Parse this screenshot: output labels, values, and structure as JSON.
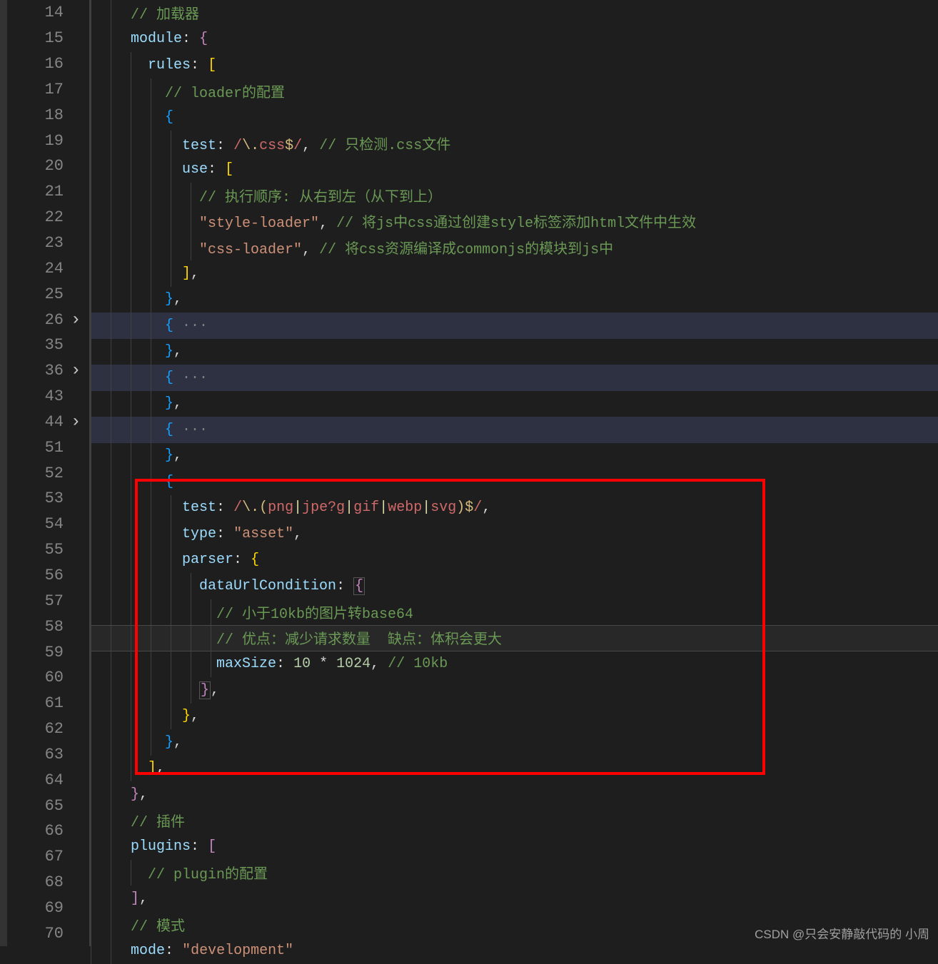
{
  "lines": [
    {
      "num": "14",
      "fold": false,
      "bg": "",
      "indent": 1,
      "tokens": [
        [
          "    ",
          "tk-default"
        ],
        [
          "// 加载器",
          "tk-comment"
        ]
      ]
    },
    {
      "num": "15",
      "fold": false,
      "bg": "",
      "indent": 1,
      "tokens": [
        [
          "    ",
          "tk-default"
        ],
        [
          "module",
          "tk-property"
        ],
        [
          ":",
          "tk-default"
        ],
        [
          " ",
          "tk-default"
        ],
        [
          "{",
          "tk-brace-purple"
        ]
      ]
    },
    {
      "num": "16",
      "fold": false,
      "bg": "",
      "indent": 2,
      "tokens": [
        [
          "      ",
          "tk-default"
        ],
        [
          "rules",
          "tk-property"
        ],
        [
          ":",
          "tk-default"
        ],
        [
          " ",
          "tk-default"
        ],
        [
          "[",
          "tk-bracket-yellow"
        ]
      ]
    },
    {
      "num": "17",
      "fold": false,
      "bg": "",
      "indent": 3,
      "tokens": [
        [
          "        ",
          "tk-default"
        ],
        [
          "// loader的配置",
          "tk-comment"
        ]
      ]
    },
    {
      "num": "18",
      "fold": false,
      "bg": "",
      "indent": 3,
      "tokens": [
        [
          "        ",
          "tk-default"
        ],
        [
          "{",
          "tk-brace-blue"
        ]
      ]
    },
    {
      "num": "19",
      "fold": false,
      "bg": "",
      "indent": 4,
      "tokens": [
        [
          "          ",
          "tk-default"
        ],
        [
          "test",
          "tk-property"
        ],
        [
          ":",
          "tk-default"
        ],
        [
          " ",
          "tk-default"
        ],
        [
          "/",
          "tk-regex"
        ],
        [
          "\\.",
          "tk-regex-esc"
        ],
        [
          "css",
          "tk-regex"
        ],
        [
          "$",
          "tk-regex-esc"
        ],
        [
          "/",
          "tk-regex"
        ],
        [
          ",",
          "tk-default"
        ],
        [
          " ",
          "tk-default"
        ],
        [
          "// 只检测.css文件",
          "tk-comment"
        ]
      ]
    },
    {
      "num": "20",
      "fold": false,
      "bg": "",
      "indent": 4,
      "tokens": [
        [
          "          ",
          "tk-default"
        ],
        [
          "use",
          "tk-property"
        ],
        [
          ":",
          "tk-default"
        ],
        [
          " ",
          "tk-default"
        ],
        [
          "[",
          "tk-brace-yellow"
        ]
      ]
    },
    {
      "num": "21",
      "fold": false,
      "bg": "",
      "indent": 5,
      "tokens": [
        [
          "            ",
          "tk-default"
        ],
        [
          "// 执行顺序: 从右到左（从下到上）",
          "tk-comment"
        ]
      ]
    },
    {
      "num": "22",
      "fold": false,
      "bg": "",
      "indent": 5,
      "tokens": [
        [
          "            ",
          "tk-default"
        ],
        [
          "\"style-loader\"",
          "tk-string"
        ],
        [
          ",",
          "tk-default"
        ],
        [
          " ",
          "tk-default"
        ],
        [
          "// 将js中css通过创建style标签添加html文件中生效",
          "tk-comment"
        ]
      ]
    },
    {
      "num": "23",
      "fold": false,
      "bg": "",
      "indent": 5,
      "tokens": [
        [
          "            ",
          "tk-default"
        ],
        [
          "\"css-loader\"",
          "tk-string"
        ],
        [
          ",",
          "tk-default"
        ],
        [
          " ",
          "tk-default"
        ],
        [
          "// 将css资源编译成commonjs的模块到js中",
          "tk-comment"
        ]
      ]
    },
    {
      "num": "24",
      "fold": false,
      "bg": "",
      "indent": 4,
      "tokens": [
        [
          "          ",
          "tk-default"
        ],
        [
          "]",
          "tk-brace-yellow"
        ],
        [
          ",",
          "tk-default"
        ]
      ]
    },
    {
      "num": "25",
      "fold": false,
      "bg": "",
      "indent": 3,
      "tokens": [
        [
          "        ",
          "tk-default"
        ],
        [
          "}",
          "tk-brace-blue"
        ],
        [
          ",",
          "tk-default"
        ]
      ]
    },
    {
      "num": "26",
      "fold": true,
      "bg": "h",
      "indent": 3,
      "tokens": [
        [
          "        ",
          "tk-default"
        ],
        [
          "{",
          "tk-brace-blue"
        ],
        [
          " ···",
          "tk-fold"
        ]
      ]
    },
    {
      "num": "35",
      "fold": false,
      "bg": "",
      "indent": 3,
      "tokens": [
        [
          "        ",
          "tk-default"
        ],
        [
          "}",
          "tk-brace-blue"
        ],
        [
          ",",
          "tk-default"
        ]
      ]
    },
    {
      "num": "36",
      "fold": true,
      "bg": "h",
      "indent": 3,
      "tokens": [
        [
          "        ",
          "tk-default"
        ],
        [
          "{",
          "tk-brace-blue"
        ],
        [
          " ···",
          "tk-fold"
        ]
      ]
    },
    {
      "num": "43",
      "fold": false,
      "bg": "",
      "indent": 3,
      "tokens": [
        [
          "        ",
          "tk-default"
        ],
        [
          "}",
          "tk-brace-blue"
        ],
        [
          ",",
          "tk-default"
        ]
      ]
    },
    {
      "num": "44",
      "fold": true,
      "bg": "h",
      "indent": 3,
      "tokens": [
        [
          "        ",
          "tk-default"
        ],
        [
          "{",
          "tk-brace-blue"
        ],
        [
          " ···",
          "tk-fold"
        ]
      ]
    },
    {
      "num": "51",
      "fold": false,
      "bg": "",
      "indent": 3,
      "tokens": [
        [
          "        ",
          "tk-default"
        ],
        [
          "}",
          "tk-brace-blue"
        ],
        [
          ",",
          "tk-default"
        ]
      ]
    },
    {
      "num": "52",
      "fold": false,
      "bg": "",
      "indent": 3,
      "tokens": [
        [
          "        ",
          "tk-default"
        ],
        [
          "{",
          "tk-brace-blue"
        ]
      ]
    },
    {
      "num": "53",
      "fold": false,
      "bg": "",
      "indent": 4,
      "tokens": [
        [
          "          ",
          "tk-default"
        ],
        [
          "test",
          "tk-property"
        ],
        [
          ":",
          "tk-default"
        ],
        [
          " ",
          "tk-default"
        ],
        [
          "/",
          "tk-regex"
        ],
        [
          "\\.",
          "tk-regex-esc"
        ],
        [
          "(",
          "tk-regex-esc"
        ],
        [
          "png",
          "tk-regex"
        ],
        [
          "|",
          "tk-regex-pipe"
        ],
        [
          "jpe?g",
          "tk-regex"
        ],
        [
          "|",
          "tk-regex-pipe"
        ],
        [
          "gif",
          "tk-regex"
        ],
        [
          "|",
          "tk-regex-pipe"
        ],
        [
          "webp",
          "tk-regex"
        ],
        [
          "|",
          "tk-regex-pipe"
        ],
        [
          "svg",
          "tk-regex"
        ],
        [
          ")",
          "tk-regex-esc"
        ],
        [
          "$",
          "tk-regex-esc"
        ],
        [
          "/",
          "tk-regex"
        ],
        [
          ",",
          "tk-default"
        ]
      ]
    },
    {
      "num": "54",
      "fold": false,
      "bg": "",
      "indent": 4,
      "tokens": [
        [
          "          ",
          "tk-default"
        ],
        [
          "type",
          "tk-property"
        ],
        [
          ":",
          "tk-default"
        ],
        [
          " ",
          "tk-default"
        ],
        [
          "\"asset\"",
          "tk-string"
        ],
        [
          ",",
          "tk-default"
        ]
      ]
    },
    {
      "num": "55",
      "fold": false,
      "bg": "",
      "indent": 4,
      "tokens": [
        [
          "          ",
          "tk-default"
        ],
        [
          "parser",
          "tk-property"
        ],
        [
          ":",
          "tk-default"
        ],
        [
          " ",
          "tk-default"
        ],
        [
          "{",
          "tk-brace-yellow"
        ]
      ]
    },
    {
      "num": "56",
      "fold": false,
      "bg": "",
      "indent": 5,
      "tokens": [
        [
          "            ",
          "tk-default"
        ],
        [
          "dataUrlCondition",
          "tk-property"
        ],
        [
          ":",
          "tk-default"
        ],
        [
          " ",
          "tk-default"
        ],
        [
          "{",
          "tk-brace-purple highlight-bracket"
        ]
      ]
    },
    {
      "num": "57",
      "fold": false,
      "bg": "",
      "indent": 6,
      "tokens": [
        [
          "              ",
          "tk-default"
        ],
        [
          "// 小于10kb的图片转base64",
          "tk-comment"
        ]
      ]
    },
    {
      "num": "58",
      "fold": false,
      "bg": "c",
      "indent": 6,
      "tokens": [
        [
          "              ",
          "tk-default"
        ],
        [
          "// 优点：减少请求数量  缺点：体积会更大",
          "tk-comment"
        ]
      ]
    },
    {
      "num": "59",
      "fold": false,
      "bg": "",
      "indent": 6,
      "tokens": [
        [
          "              ",
          "tk-default"
        ],
        [
          "maxSize",
          "tk-property"
        ],
        [
          ":",
          "tk-default"
        ],
        [
          " ",
          "tk-default"
        ],
        [
          "10",
          "tk-number"
        ],
        [
          " ",
          "tk-default"
        ],
        [
          "*",
          "tk-default"
        ],
        [
          " ",
          "tk-default"
        ],
        [
          "1024",
          "tk-number"
        ],
        [
          ",",
          "tk-default"
        ],
        [
          " ",
          "tk-default"
        ],
        [
          "// 10kb",
          "tk-comment"
        ]
      ]
    },
    {
      "num": "60",
      "fold": false,
      "bg": "",
      "indent": 5,
      "tokens": [
        [
          "            ",
          "tk-default"
        ],
        [
          "}",
          "tk-brace-purple highlight-bracket"
        ],
        [
          ",",
          "tk-default"
        ]
      ]
    },
    {
      "num": "61",
      "fold": false,
      "bg": "",
      "indent": 4,
      "tokens": [
        [
          "          ",
          "tk-default"
        ],
        [
          "}",
          "tk-brace-yellow"
        ],
        [
          ",",
          "tk-default"
        ]
      ]
    },
    {
      "num": "62",
      "fold": false,
      "bg": "",
      "indent": 3,
      "tokens": [
        [
          "        ",
          "tk-default"
        ],
        [
          "}",
          "tk-brace-blue"
        ],
        [
          ",",
          "tk-default"
        ]
      ]
    },
    {
      "num": "63",
      "fold": false,
      "bg": "",
      "indent": 2,
      "tokens": [
        [
          "      ",
          "tk-default"
        ],
        [
          "]",
          "tk-bracket-yellow"
        ],
        [
          ",",
          "tk-default"
        ]
      ]
    },
    {
      "num": "64",
      "fold": false,
      "bg": "",
      "indent": 1,
      "tokens": [
        [
          "    ",
          "tk-default"
        ],
        [
          "}",
          "tk-brace-purple"
        ],
        [
          ",",
          "tk-default"
        ]
      ]
    },
    {
      "num": "65",
      "fold": false,
      "bg": "",
      "indent": 1,
      "tokens": [
        [
          "    ",
          "tk-default"
        ],
        [
          "// 插件",
          "tk-comment"
        ]
      ]
    },
    {
      "num": "66",
      "fold": false,
      "bg": "",
      "indent": 1,
      "tokens": [
        [
          "    ",
          "tk-default"
        ],
        [
          "plugins",
          "tk-property"
        ],
        [
          ":",
          "tk-default"
        ],
        [
          " ",
          "tk-default"
        ],
        [
          "[",
          "tk-brace-purple"
        ]
      ]
    },
    {
      "num": "67",
      "fold": false,
      "bg": "",
      "indent": 2,
      "tokens": [
        [
          "      ",
          "tk-default"
        ],
        [
          "// plugin的配置",
          "tk-comment"
        ]
      ]
    },
    {
      "num": "68",
      "fold": false,
      "bg": "",
      "indent": 1,
      "tokens": [
        [
          "    ",
          "tk-default"
        ],
        [
          "]",
          "tk-brace-purple"
        ],
        [
          ",",
          "tk-default"
        ]
      ]
    },
    {
      "num": "69",
      "fold": false,
      "bg": "",
      "indent": 1,
      "tokens": [
        [
          "    ",
          "tk-default"
        ],
        [
          "// 模式",
          "tk-comment"
        ]
      ]
    },
    {
      "num": "70",
      "fold": false,
      "bg": "",
      "indent": 1,
      "tokens": [
        [
          "    ",
          "tk-default"
        ],
        [
          "mode",
          "tk-property"
        ],
        [
          ":",
          "tk-default"
        ],
        [
          " ",
          "tk-default"
        ],
        [
          "\"development\"",
          "tk-string"
        ]
      ]
    }
  ],
  "watermark": "CSDN @只会安静敲代码的 小周"
}
